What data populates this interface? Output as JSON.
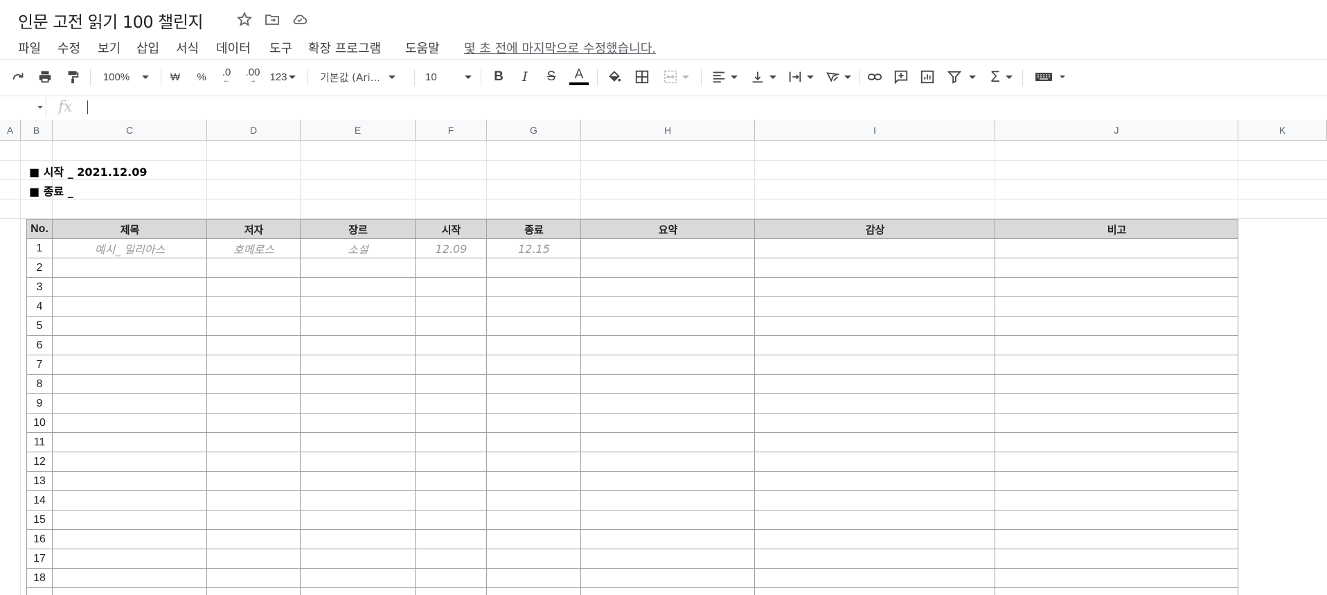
{
  "doc": {
    "title": "인문 고전 읽기 100 챌린지"
  },
  "menu": [
    "파일",
    "수정",
    "보기",
    "삽입",
    "서식",
    "데이터",
    "도구",
    "확장 프로그램",
    "도움말"
  ],
  "last_edit": "몇 초 전에 마지막으로 수정했습니다.",
  "toolbar": {
    "zoom": "100%",
    "currency": "₩",
    "percent": "%",
    "dec_decrease": ".0",
    "dec_increase": ".00",
    "format_more": "123",
    "font": "기본값 (Ari...",
    "font_size": "10",
    "bold": "B",
    "italic": "I",
    "strike": "S",
    "text_color": "A",
    "sum": "Σ"
  },
  "formula": {
    "fx": "fx",
    "value": ""
  },
  "columns": [
    "A",
    "B",
    "C",
    "D",
    "E",
    "F",
    "G",
    "H",
    "I",
    "J",
    "K"
  ],
  "info": {
    "start": "■ 시작 _ 2021.12.09",
    "end": "■ 종료 _"
  },
  "table": {
    "headers": [
      "No.",
      "제목",
      "저자",
      "장르",
      "시작",
      "종료",
      "요약",
      "감상",
      "비고"
    ],
    "example": {
      "no": "1",
      "title": "예시_ 일리아스",
      "author": "호메로스",
      "genre": "소설",
      "start": "12.09",
      "end": "12.15"
    },
    "row_numbers": [
      "2",
      "3",
      "4",
      "5",
      "6",
      "7",
      "8",
      "9",
      "10",
      "11",
      "12",
      "13",
      "14",
      "15",
      "16",
      "17",
      "18"
    ]
  },
  "colors": {
    "header_bg": "#d9d9d9",
    "grid": "#e2e2e2",
    "example_text": "#999999"
  }
}
